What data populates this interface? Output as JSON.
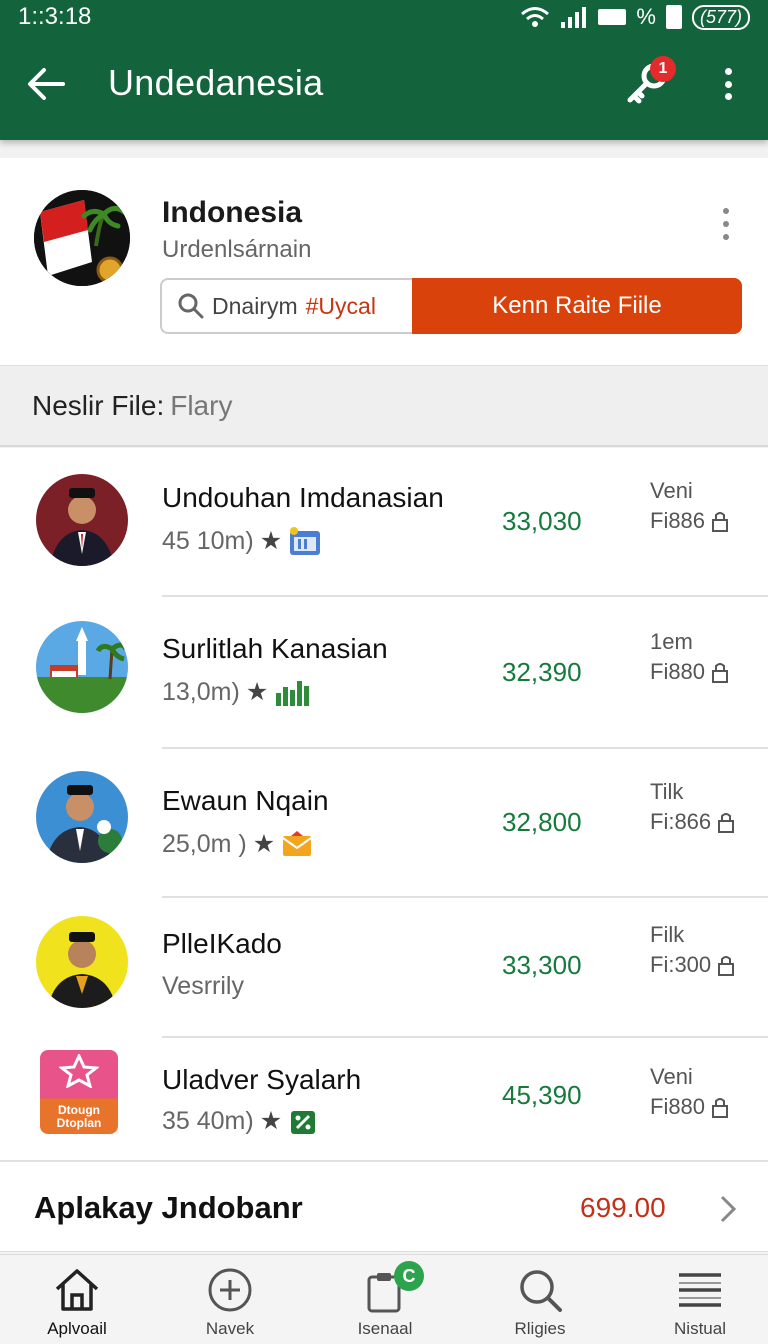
{
  "status": {
    "time": "1::3:18",
    "icons": [
      "wifi-icon",
      "signal-icon",
      "battery-icon"
    ],
    "percent": "%",
    "pill": "(577)"
  },
  "appbar": {
    "title": "Undedanesia",
    "notification_count": "1",
    "color": "#13643d"
  },
  "profile": {
    "name": "Indonesia",
    "subtitle": "Urdenlsárnain",
    "search_text": "Dnairym",
    "search_tag": "#Uycal",
    "action_label": "Kenn Raite Fiile"
  },
  "section": {
    "label": "Neslir File:",
    "value": "Flary"
  },
  "rows": [
    {
      "name": "Undouhan Imdanasian",
      "sub": "45 10m)",
      "value": "33,030",
      "top": "Veni",
      "bottom": "Fi886"
    },
    {
      "name": "Surlitlah Kanasian",
      "sub": "13,0m)",
      "value": "32,390",
      "top": "1em",
      "bottom": "Fi880"
    },
    {
      "name": "Ewaun Nqain",
      "sub": "25,0m )",
      "value": "32,800",
      "top": "Tilk",
      "bottom": "Fi:866"
    },
    {
      "name": "PlleIKado",
      "sub": "Vesrrily",
      "value": "33,300",
      "top": "Filk",
      "bottom": "Fi:300"
    },
    {
      "name": "Uladver Syalarh",
      "sub": "35 40m)",
      "value": "45,390",
      "top": "Veni",
      "bottom": "Fi880",
      "logo_text": "Dtougn Dtoplan"
    }
  ],
  "footer": {
    "title": "Aplakay Jndobanr",
    "price": "699.00"
  },
  "nav": [
    {
      "label": "Aplvoail",
      "icon": "home-icon"
    },
    {
      "label": "Navek",
      "icon": "add-circle-icon"
    },
    {
      "label": "Isenaal",
      "icon": "clipboard-icon",
      "badge": "C"
    },
    {
      "label": "Rligies",
      "icon": "search-icon"
    },
    {
      "label": "Nistual",
      "icon": "menu-icon"
    }
  ],
  "colors": {
    "accent": "#d9430b",
    "value_green": "#157a3c",
    "price_red": "#c3311a"
  }
}
